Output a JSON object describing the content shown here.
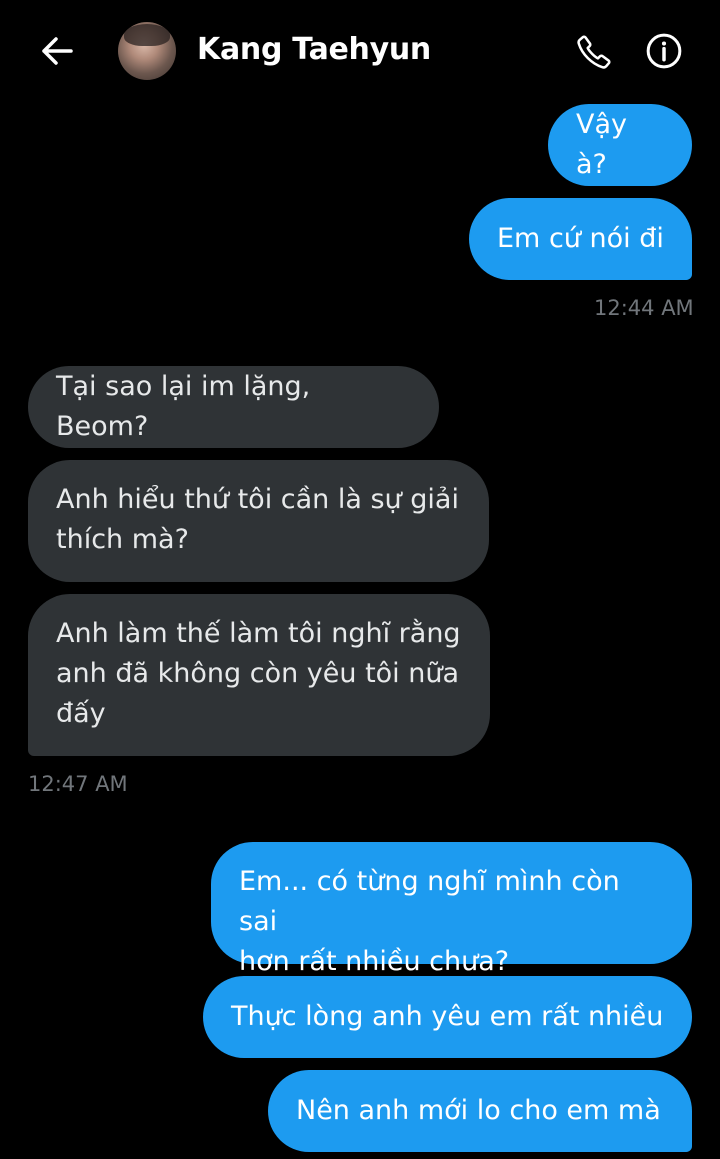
{
  "header": {
    "contact_name": "Kang Taehyun",
    "back_icon": "arrow-left-icon",
    "call_icon": "phone-icon",
    "info_icon": "info-icon"
  },
  "messages": [
    {
      "direction": "sent",
      "text": "Vậy à?"
    },
    {
      "direction": "sent",
      "text": "Em cứ nói đi"
    },
    {
      "direction": "timestamp",
      "text": "12:44 AM"
    },
    {
      "direction": "received",
      "text": "Tại sao lại im lặng, Beom?"
    },
    {
      "direction": "received",
      "lines": [
        "Anh hiểu thứ tôi cần là sự giải",
        "thích mà?"
      ]
    },
    {
      "direction": "received",
      "lines": [
        "Anh làm thế làm tôi nghĩ rằng",
        "anh đã không còn yêu tôi nữa",
        "đấy"
      ]
    },
    {
      "direction": "timestamp",
      "text": "12:47 AM"
    },
    {
      "direction": "sent",
      "lines": [
        "Em... có từng nghĩ mình còn sai",
        "hơn rất nhiều chưa?"
      ]
    },
    {
      "direction": "sent",
      "text": "Thực lòng anh yêu em rất nhiều"
    },
    {
      "direction": "sent",
      "text": "Nên anh mới lo cho em mà"
    }
  ],
  "colors": {
    "background": "#000000",
    "sent_bubble": "#1d9bf0",
    "received_bubble": "#2f3336",
    "timestamp": "#71767b"
  }
}
